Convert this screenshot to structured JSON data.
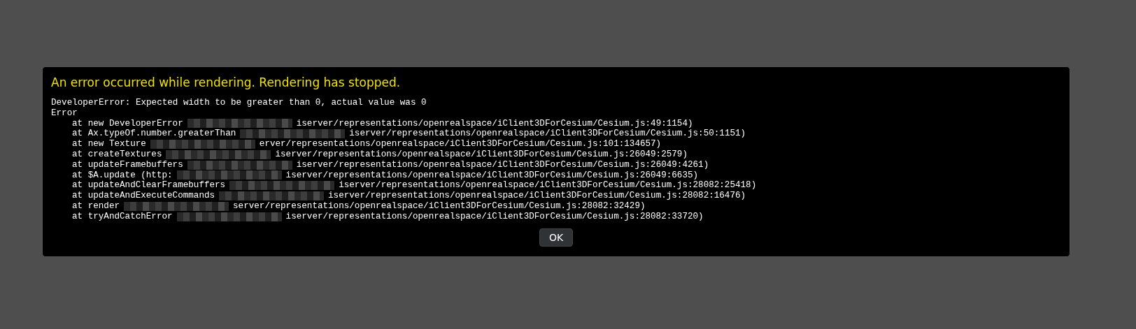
{
  "dialog": {
    "title": "An error occurred while rendering. Rendering has stopped.",
    "message": "DeveloperError: Expected width to be greater than 0, actual value was 0",
    "error_label": "Error",
    "stack": [
      {
        "call": "at new DeveloperError",
        "location": "iserver/representations/openrealspace/iClient3DForCesium/Cesium.js:49:1154)"
      },
      {
        "call": "at Ax.typeOf.number.greaterThan",
        "location": "iserver/representations/openrealspace/iClient3DForCesium/Cesium.js:50:1151)"
      },
      {
        "call": "at new Texture",
        "location": "erver/representations/openrealspace/iClient3DForCesium/Cesium.js:101:134657)"
      },
      {
        "call": "at createTextures",
        "location": "iserver/representations/openrealspace/iClient3DForCesium/Cesium.js:26049:2579)"
      },
      {
        "call": "at updateFramebuffers",
        "location": "iserver/representations/openrealspace/iClient3DForCesium/Cesium.js:26049:4261)"
      },
      {
        "call": "at $A.update (http:",
        "location": "iserver/representations/openrealspace/iClient3DForCesium/Cesium.js:26049:6635)"
      },
      {
        "call": "at updateAndClearFramebuffers",
        "location": "iserver/representations/openrealspace/iClient3DForCesium/Cesium.js:28082:25418)"
      },
      {
        "call": "at updateAndExecuteCommands",
        "location": "iserver/representations/openrealspace/iClient3DForCesium/Cesium.js:28082:16476)"
      },
      {
        "call": "at render",
        "location": "server/representations/openrealspace/iClient3DForCesium/Cesium.js:28082:32429)"
      },
      {
        "call": "at tryAndCatchError",
        "location": "iserver/representations/openrealspace/iClient3DForCesium/Cesium.js:28082:33720)"
      }
    ],
    "button": "OK"
  }
}
